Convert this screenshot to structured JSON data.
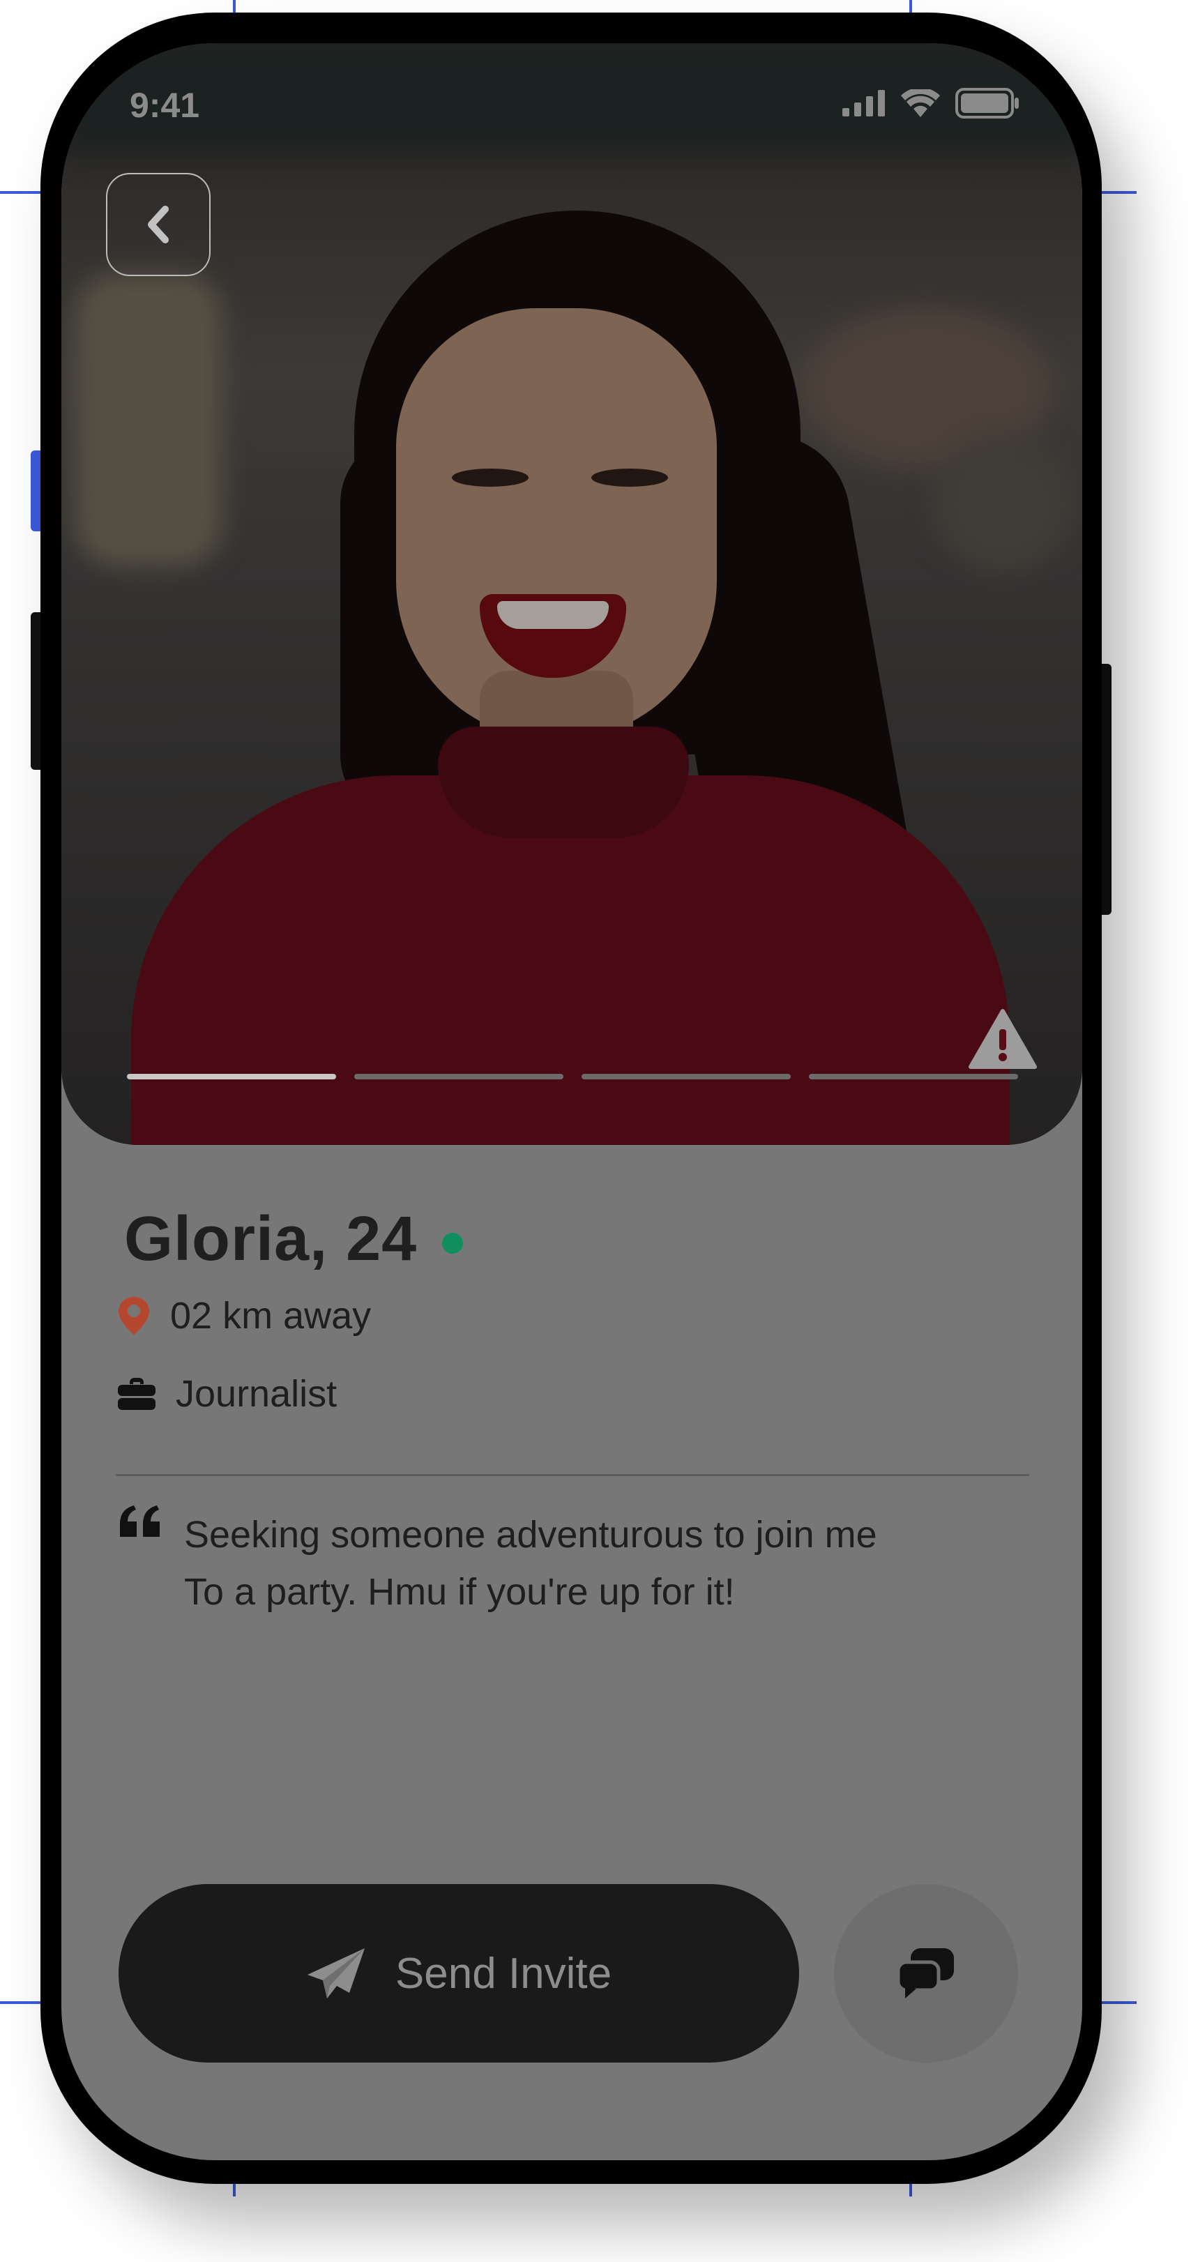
{
  "status_bar": {
    "time": "9:41",
    "icons": [
      "signal-icon",
      "wifi-icon",
      "battery-icon"
    ]
  },
  "header": {
    "back_icon": "chevron-left-icon"
  },
  "photo": {
    "image_count": 4,
    "active_index": 0,
    "report_icon": "warning-icon"
  },
  "profile": {
    "name": "Gloria, 24",
    "online": true,
    "distance": "02 km away",
    "occupation": "Journalist",
    "bio_line1": "Seeking someone adventurous to join me",
    "bio_line2": "To a party. Hmu if you're up for it!"
  },
  "actions": {
    "send_invite_label": "Send Invite",
    "send_icon": "paper-plane-icon",
    "chat_icon": "chat-bubbles-icon"
  },
  "colors": {
    "online": "#0f8f5e",
    "location_pin": "#b5472f",
    "screen_overlay": "#777777",
    "button_dark": "#1a1a1a"
  }
}
